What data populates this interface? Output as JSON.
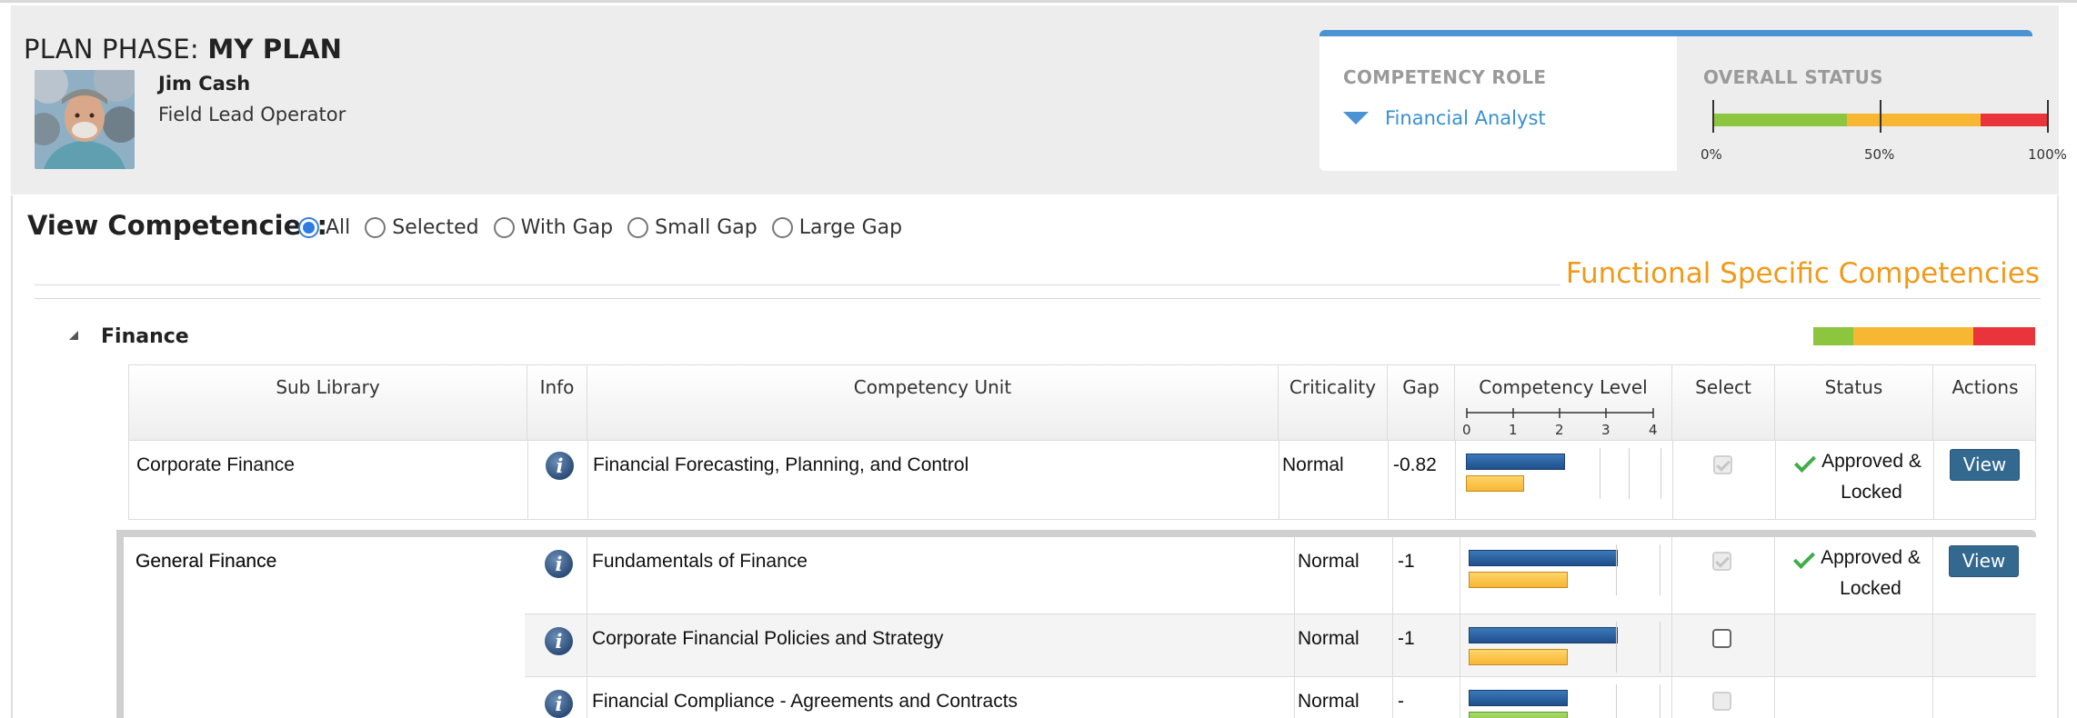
{
  "header": {
    "plan_phase_prefix": "PLAN PHASE: ",
    "plan_phase_value": "MY PLAN",
    "user": {
      "name": "Jim Cash",
      "role": "Field Lead Operator"
    },
    "competency_role": {
      "label": "COMPETENCY ROLE",
      "value": "Financial Analyst"
    },
    "overall_status": {
      "label": "OVERALL STATUS",
      "segments": [
        {
          "color": "#8cc63e",
          "fraction": 0.4
        },
        {
          "color": "#f7b733",
          "fraction": 0.4
        },
        {
          "color": "#e8343a",
          "fraction": 0.2
        }
      ],
      "ticks": [
        "0%",
        "50%",
        "100%"
      ]
    }
  },
  "filter": {
    "label": "View Competencies:",
    "options": [
      "All",
      "Selected",
      "With Gap",
      "Small Gap",
      "Large Gap"
    ],
    "selected": "All"
  },
  "section_title": "Functional Specific Competencies",
  "group": {
    "title": "Finance",
    "status_segments": [
      {
        "color": "#8cc63e",
        "fraction": 0.18
      },
      {
        "color": "#f7b733",
        "fraction": 0.54
      },
      {
        "color": "#e8343a",
        "fraction": 0.28
      }
    ]
  },
  "table": {
    "headers": {
      "sub_library": "Sub Library",
      "info": "Info",
      "competency_unit": "Competency Unit",
      "criticality": "Criticality",
      "gap": "Gap",
      "competency_level": "Competency Level",
      "select": "Select",
      "status": "Status",
      "actions": "Actions"
    },
    "level_scale": [
      "0",
      "1",
      "2",
      "3",
      "4"
    ],
    "rows": [
      {
        "sub_library": "Corporate Finance",
        "unit": "Financial Forecasting, Planning, and Control",
        "criticality": "Normal",
        "gap": "-0.82",
        "required_level": 2,
        "current_level": 1.18,
        "current_color": "orange",
        "selected": true,
        "select_disabled": true,
        "status_line1": "Approved &",
        "status_line2": "Locked",
        "action": "View"
      },
      {
        "sub_library": "General Finance",
        "unit": "Fundamentals of Finance",
        "criticality": "Normal",
        "gap": "-1",
        "required_level": 3,
        "current_level": 2,
        "current_color": "orange",
        "selected": true,
        "select_disabled": true,
        "status_line1": "Approved &",
        "status_line2": "Locked",
        "action": "View"
      },
      {
        "sub_library": "",
        "unit": "Corporate Financial Policies and Strategy",
        "criticality": "Normal",
        "gap": "-1",
        "required_level": 3,
        "current_level": 2,
        "current_color": "orange",
        "selected": false,
        "select_disabled": false,
        "status_line1": "",
        "status_line2": "",
        "action": ""
      },
      {
        "sub_library": "",
        "unit": "Financial Compliance - Agreements and Contracts",
        "criticality": "Normal",
        "gap": "-",
        "required_level": 2,
        "current_level": 2,
        "current_color": "green",
        "selected": false,
        "select_disabled": true,
        "status_line1": "",
        "status_line2": "",
        "action": ""
      }
    ]
  }
}
